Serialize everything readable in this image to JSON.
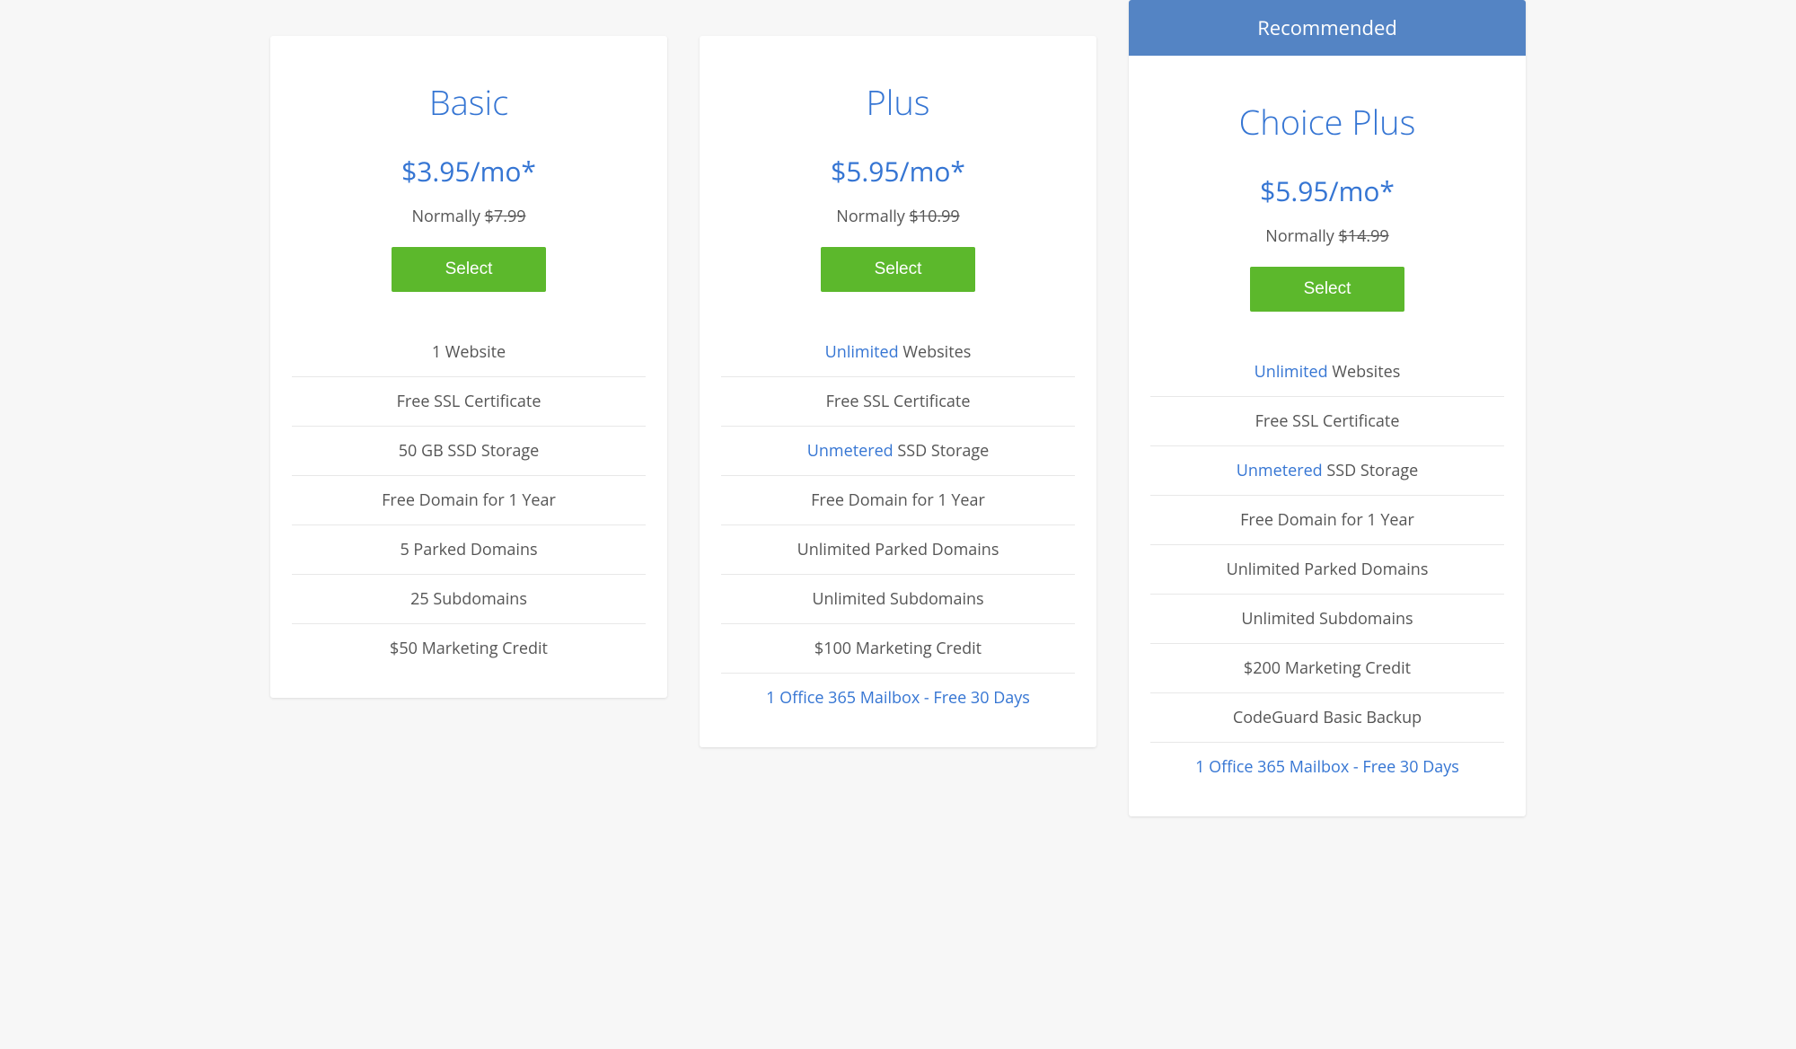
{
  "recommended_label": "Recommended",
  "select_button_label": "Select",
  "normally_label": "Normally",
  "plans": [
    {
      "name": "Basic",
      "price": "$3.95/mo*",
      "normal_price": "$7.99",
      "recommended": false,
      "features": [
        {
          "prefix": "",
          "highlight": "",
          "text": "1 Website",
          "link": false
        },
        {
          "prefix": "",
          "highlight": "",
          "text": "Free SSL Certificate",
          "link": false
        },
        {
          "prefix": "",
          "highlight": "",
          "text": "50 GB SSD Storage",
          "link": false
        },
        {
          "prefix": "",
          "highlight": "",
          "text": "Free Domain for 1 Year",
          "link": false
        },
        {
          "prefix": "",
          "highlight": "",
          "text": "5 Parked Domains",
          "link": false
        },
        {
          "prefix": "",
          "highlight": "",
          "text": "25 Subdomains",
          "link": false
        },
        {
          "prefix": "",
          "highlight": "",
          "text": "$50 Marketing Credit",
          "link": false
        }
      ]
    },
    {
      "name": "Plus",
      "price": "$5.95/mo*",
      "normal_price": "$10.99",
      "recommended": false,
      "features": [
        {
          "prefix": "",
          "highlight": "Unlimited",
          "text": " Websites",
          "link": false
        },
        {
          "prefix": "",
          "highlight": "",
          "text": "Free SSL Certificate",
          "link": false
        },
        {
          "prefix": "",
          "highlight": "Unmetered",
          "text": " SSD Storage",
          "link": false
        },
        {
          "prefix": "",
          "highlight": "",
          "text": "Free Domain for 1 Year",
          "link": false
        },
        {
          "prefix": "",
          "highlight": "",
          "text": "Unlimited Parked Domains",
          "link": false
        },
        {
          "prefix": "",
          "highlight": "",
          "text": "Unlimited Subdomains",
          "link": false
        },
        {
          "prefix": "",
          "highlight": "",
          "text": "$100 Marketing Credit",
          "link": false
        },
        {
          "prefix": "",
          "highlight": "1 Office 365 Mailbox - Free 30 Days",
          "text": "",
          "link": true
        }
      ]
    },
    {
      "name": "Choice Plus",
      "price": "$5.95/mo*",
      "normal_price": "$14.99",
      "recommended": true,
      "features": [
        {
          "prefix": "",
          "highlight": "Unlimited",
          "text": " Websites",
          "link": false
        },
        {
          "prefix": "",
          "highlight": "",
          "text": "Free SSL Certificate",
          "link": false
        },
        {
          "prefix": "",
          "highlight": "Unmetered",
          "text": " SSD Storage",
          "link": false
        },
        {
          "prefix": "",
          "highlight": "",
          "text": "Free Domain for 1 Year",
          "link": false
        },
        {
          "prefix": "",
          "highlight": "",
          "text": "Unlimited Parked Domains",
          "link": false
        },
        {
          "prefix": "",
          "highlight": "",
          "text": "Unlimited Subdomains",
          "link": false
        },
        {
          "prefix": "",
          "highlight": "",
          "text": "$200 Marketing Credit",
          "link": false
        },
        {
          "prefix": "",
          "highlight": "",
          "text": "CodeGuard Basic Backup",
          "link": false
        },
        {
          "prefix": "",
          "highlight": "1 Office 365 Mailbox - Free 30 Days",
          "text": "",
          "link": true
        }
      ]
    }
  ]
}
